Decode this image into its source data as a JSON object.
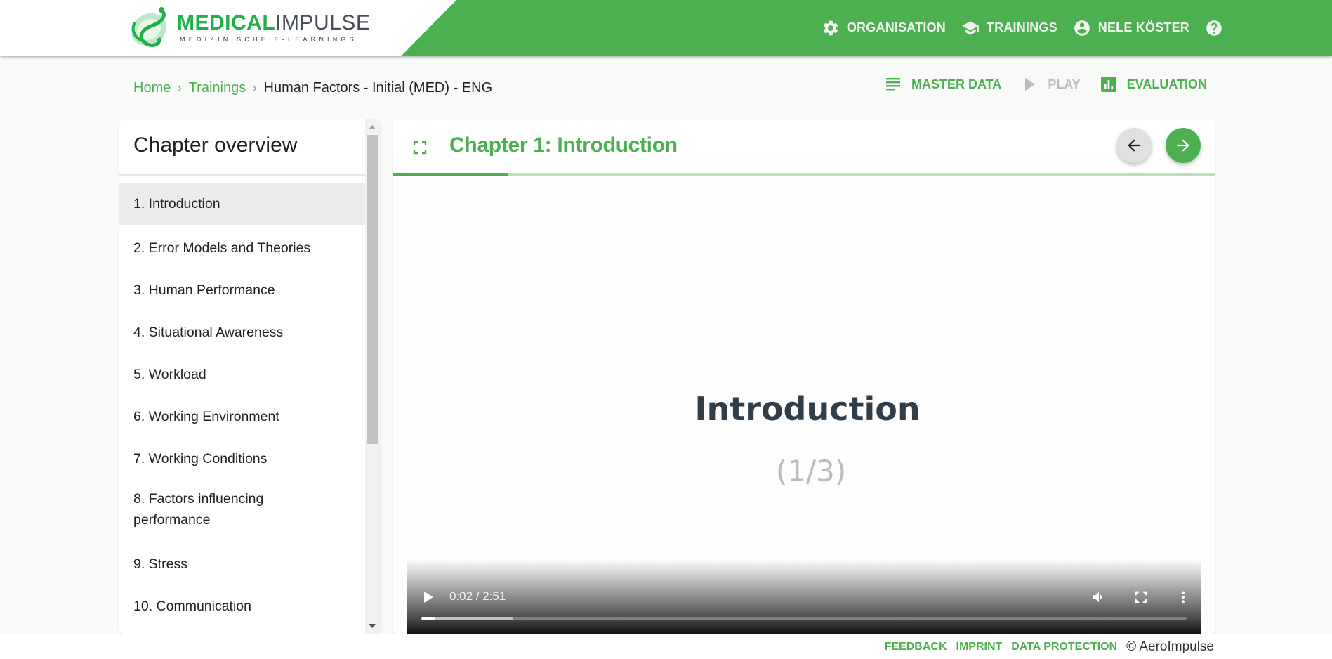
{
  "brand": {
    "name_primary": "MEDICAL",
    "name_secondary": "IMPULSE",
    "tagline": "MEDIZINISCHE E-LEARNINGS",
    "accent_color": "#4caf50"
  },
  "topnav": {
    "items": [
      {
        "label": "ORGANISATION",
        "icon": "gear-icon"
      },
      {
        "label": "TRAININGS",
        "icon": "graduation-cap-icon"
      },
      {
        "label": "NELE KÖSTER",
        "icon": "account-circle-icon"
      }
    ],
    "help_icon": "help-circle-icon"
  },
  "breadcrumb": {
    "items": [
      "Home",
      "Trainings"
    ],
    "current": "Human Factors - Initial (MED) - ENG",
    "separator": "›"
  },
  "subnav": {
    "items": [
      {
        "label": "MASTER DATA",
        "icon": "list-icon",
        "state": "active"
      },
      {
        "label": "PLAY",
        "icon": "play-icon",
        "state": "disabled"
      },
      {
        "label": "EVALUATION",
        "icon": "bar-chart-icon",
        "state": "active"
      }
    ]
  },
  "sidebar": {
    "title": "Chapter overview",
    "chapters": [
      {
        "label": "1. Introduction",
        "active": true
      },
      {
        "label": "2. Error Models and Theories"
      },
      {
        "label": "3. Human Performance"
      },
      {
        "label": "4. Situational Awareness"
      },
      {
        "label": "5. Workload"
      },
      {
        "label": "6. Working Environment"
      },
      {
        "label": "7. Working Conditions"
      },
      {
        "label": "8. Factors influencing performance"
      },
      {
        "label": "9. Stress"
      },
      {
        "label": "10. Communication"
      }
    ]
  },
  "content": {
    "chapter_title": "Chapter 1: Introduction",
    "chapter_progress_percent": 14,
    "slide_title": "Introduction",
    "slide_counter": "(1/3)",
    "video": {
      "time_display": "0:02 / 2:51",
      "played_percent": 1.8,
      "buffered_percent": 12
    }
  },
  "footer": {
    "links": [
      "FEEDBACK",
      "IMPRINT",
      "DATA PROTECTION"
    ],
    "copyright": "© AeroImpulse"
  }
}
